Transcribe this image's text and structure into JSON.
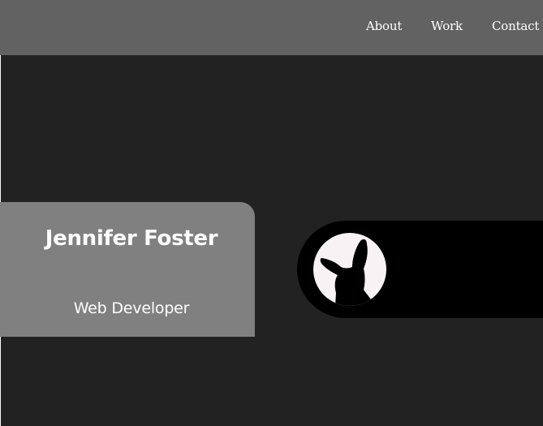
{
  "nav": {
    "items": [
      {
        "label": "About"
      },
      {
        "label": "Work"
      },
      {
        "label": "Contact"
      }
    ]
  },
  "profile": {
    "name": "Jennifer Foster",
    "role": "Web Developer",
    "avatar_icon": "dog-silhouette-icon"
  },
  "colors": {
    "header_bg": "#626262",
    "page_bg": "#222222",
    "card_bg": "#808080",
    "pill_bg": "#000000",
    "avatar_bg": "#f8f2f4"
  }
}
